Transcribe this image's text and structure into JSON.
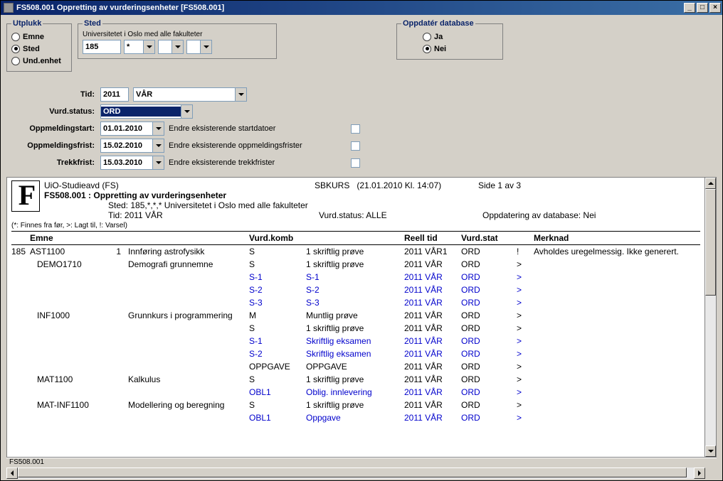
{
  "title": "FS508.001 Oppretting av vurderingsenheter [FS508.001]",
  "utplukk": {
    "legend": "Utplukk",
    "emne": "Emne",
    "sted": "Sted",
    "und": "Und.enhet",
    "selected": "sted"
  },
  "sted": {
    "legend": "Sted",
    "caption": "Universitetet i Oslo med alle fakulteter",
    "v1": "185",
    "v2": "*"
  },
  "oppd": {
    "legend": "Oppdatér database",
    "ja": "Ja",
    "nei": "Nei",
    "selected": "nei"
  },
  "form": {
    "tid_label": "Tid:",
    "tid_year": "2011",
    "tid_sem": "VÅR",
    "vurdstatus_label": "Vurd.status:",
    "vurdstatus": "ORD",
    "oppmstart_label": "Oppmeldingstart:",
    "oppmstart": "01.01.2010",
    "oppmstart_chk": "Endre eksisterende startdatoer",
    "oppmfrist_label": "Oppmeldingsfrist:",
    "oppmfrist": "15.02.2010",
    "oppmfrist_chk": "Endre eksisterende oppmeldingsfrister",
    "trekk_label": "Trekkfrist:",
    "trekk": "15.03.2010",
    "trekk_chk": "Endre eksisterende trekkfrister"
  },
  "report": {
    "org": "UiO-Studieavd (FS)",
    "sys": "SBKURS",
    "ts": "(21.01.2010 Kl. 14:07)",
    "page": "Side 1 av 3",
    "title": "FS508.001 : Oppretting av vurderingsenheter",
    "sted_line": "Sted: 185,*,*,* Universitetet i Oslo med alle fakulteter",
    "tid_line": "Tid:       2011 VÅR",
    "vs_line": "Vurd.status: ALLE",
    "db_line": "Oppdatering av database:   Nei",
    "note": "(*: Finnes fra før, >: Lagt til, !: Varsel)",
    "h_emne": "Emne",
    "h_vk": "Vurd.komb",
    "h_rt": "Reell tid",
    "h_vs": "Vurd.stat",
    "h_m": "Merknad",
    "rows": [
      {
        "inst": "185",
        "code": "AST1100",
        "n": "1",
        "name": "Innføring astrofysikk",
        "vk": "S",
        "desc": "1 skriftlig prøve",
        "tid": "2011 VÅR1",
        "stat": "ORD",
        "mark": "!",
        "merk": "Avholdes uregelmessig. Ikke generert.",
        "blue": false
      },
      {
        "inst": "",
        "code": "DEMO1710",
        "n": "",
        "name": "Demografi grunnemne",
        "vk": "S",
        "desc": "1 skriftlig prøve",
        "tid": "2011 VÅR",
        "stat": "ORD",
        "mark": ">",
        "merk": "",
        "blue": false
      },
      {
        "inst": "",
        "code": "",
        "n": "",
        "name": "",
        "vk": "S-1",
        "desc": "S-1",
        "tid": "2011 VÅR",
        "stat": "ORD",
        "mark": ">",
        "merk": "",
        "blue": true
      },
      {
        "inst": "",
        "code": "",
        "n": "",
        "name": "",
        "vk": "S-2",
        "desc": "S-2",
        "tid": "2011 VÅR",
        "stat": "ORD",
        "mark": ">",
        "merk": "",
        "blue": true
      },
      {
        "inst": "",
        "code": "",
        "n": "",
        "name": "",
        "vk": "S-3",
        "desc": "S-3",
        "tid": "2011 VÅR",
        "stat": "ORD",
        "mark": ">",
        "merk": "",
        "blue": true
      },
      {
        "inst": "",
        "code": "INF1000",
        "n": "",
        "name": "Grunnkurs i programmering",
        "vk": "M",
        "desc": "Muntlig prøve",
        "tid": "2011 VÅR",
        "stat": "ORD",
        "mark": ">",
        "merk": "",
        "blue": false
      },
      {
        "inst": "",
        "code": "",
        "n": "",
        "name": "",
        "vk": "S",
        "desc": "1 skriftlig prøve",
        "tid": "2011 VÅR",
        "stat": "ORD",
        "mark": ">",
        "merk": "",
        "blue": false
      },
      {
        "inst": "",
        "code": "",
        "n": "",
        "name": "",
        "vk": "S-1",
        "desc": "Skriftlig eksamen",
        "tid": "2011 VÅR",
        "stat": "ORD",
        "mark": ">",
        "merk": "",
        "blue": true
      },
      {
        "inst": "",
        "code": "",
        "n": "",
        "name": "",
        "vk": "S-2",
        "desc": "Skriftlig eksamen",
        "tid": "2011 VÅR",
        "stat": "ORD",
        "mark": ">",
        "merk": "",
        "blue": true
      },
      {
        "inst": "",
        "code": "",
        "n": "",
        "name": "",
        "vk": "OPPGAVE",
        "desc": "OPPGAVE",
        "tid": "2011 VÅR",
        "stat": "ORD",
        "mark": ">",
        "merk": "",
        "blue": false
      },
      {
        "inst": "",
        "code": "MAT1100",
        "n": "",
        "name": "Kalkulus",
        "vk": "S",
        "desc": "1 skriftlig prøve",
        "tid": "2011 VÅR",
        "stat": "ORD",
        "mark": ">",
        "merk": "",
        "blue": false
      },
      {
        "inst": "",
        "code": "",
        "n": "",
        "name": "",
        "vk": "OBL1",
        "desc": "Oblig. innlevering",
        "tid": "2011 VÅR",
        "stat": "ORD",
        "mark": ">",
        "merk": "",
        "blue": true
      },
      {
        "inst": "",
        "code": "MAT-INF1100",
        "n": "",
        "name": "Modellering og beregning",
        "vk": "S",
        "desc": "1 skriftlig prøve",
        "tid": "2011 VÅR",
        "stat": "ORD",
        "mark": ">",
        "merk": "",
        "blue": false
      },
      {
        "inst": "",
        "code": "",
        "n": "",
        "name": "",
        "vk": "OBL1",
        "desc": "Oppgave",
        "tid": "2011 VÅR",
        "stat": "ORD",
        "mark": ">",
        "merk": "",
        "blue": true
      }
    ]
  },
  "status": "FS508.001"
}
